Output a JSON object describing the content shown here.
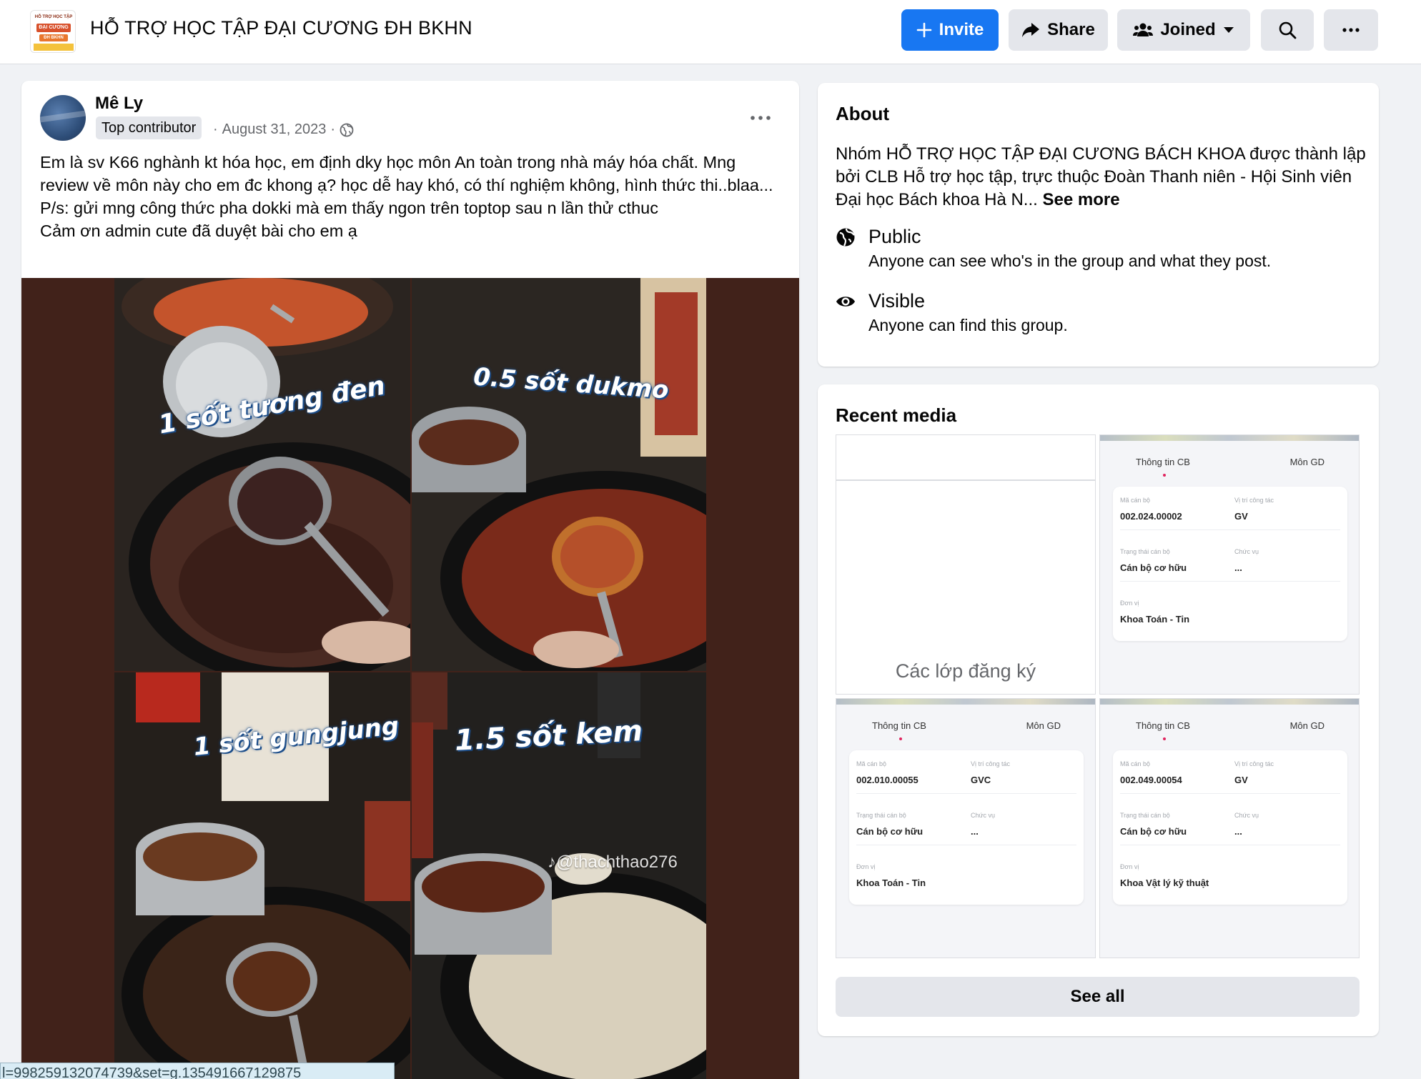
{
  "header": {
    "group_title": "HỖ TRỢ HỌC TẬP ĐẠI CƯƠNG ĐH BKHN",
    "logo_lines": [
      "HỖ TRỢ HỌC TẬP",
      "ĐẠI CƯƠNG",
      "ĐH BKHN"
    ],
    "invite_label": "Invite",
    "share_label": "Share",
    "joined_label": "Joined",
    "accent_color": "#1877f2"
  },
  "post": {
    "author": "Mê Ly",
    "badge": "Top contributor",
    "date": "August 31, 2023",
    "audience_icon": "globe-icon",
    "text_lines": [
      "Em là sv K66 nghành kt hóa học, em định dky học môn An toàn trong nhà máy hóa chất. Mng review về môn này cho em đc khong ạ? học dễ hay khó, có thí nghiệm không, hình thức thi..blaa...",
      "P/s: gửi mng công thức pha dokki mà em thấy ngon trên toptop sau n lần thử cthuc",
      "Cảm ơn admin cute đã duyệt bài cho em ạ"
    ],
    "image_labels": [
      "1 sốt tương đen",
      "0.5 sốt dukmo",
      "1 sốt gungjung",
      "1.5 sốt kem"
    ],
    "watermark": "♪@thachthao276",
    "status_url": "l=998259132074739&set=g.135491667129875"
  },
  "about": {
    "title": "About",
    "description": "Nhóm HỖ TRỢ HỌC TẬP ĐẠI CƯƠNG BÁCH KHOA được thành lập bởi CLB Hỗ trợ học tập, trực thuộc Đoàn Thanh niên - Hội Sinh viên Đại học Bách khoa Hà N...",
    "see_more": "See more",
    "privacy": {
      "title": "Public",
      "subtitle": "Anyone can see who's in the group and what they post."
    },
    "visibility": {
      "title": "Visible",
      "subtitle": "Anyone can find this group."
    }
  },
  "recent_media": {
    "title": "Recent media",
    "see_all": "See all",
    "blank_thumb_title": "Các lớp đăng ký",
    "thumbs": [
      {
        "tab1": "Thông tin CB",
        "tab2": "Môn GD",
        "l1": "Mã cán bộ",
        "v1": "002.024.00002",
        "l2": "Vị trí công tác",
        "v2": "GV",
        "l3": "Trạng thái cán bộ",
        "v3": "Cán bộ cơ hữu",
        "l4": "Chức vụ",
        "v4": "...",
        "l5": "Đơn vị",
        "v5": "Khoa Toán - Tin"
      },
      {
        "tab1": "Thông tin CB",
        "tab2": "Môn GD",
        "l1": "Mã cán bộ",
        "v1": "002.010.00055",
        "l2": "Vị trí công tác",
        "v2": "GVC",
        "l3": "Trạng thái cán bộ",
        "v3": "Cán bộ cơ hữu",
        "l4": "Chức vụ",
        "v4": "...",
        "l5": "Đơn vị",
        "v5": "Khoa Toán - Tin"
      },
      {
        "tab1": "Thông tin CB",
        "tab2": "Môn GD",
        "l1": "Mã cán bộ",
        "v1": "002.049.00054",
        "l2": "Vị trí công tác",
        "v2": "GV",
        "l3": "Trạng thái cán bộ",
        "v3": "Cán bộ cơ hữu",
        "l4": "Chức vụ",
        "v4": "...",
        "l5": "Đơn vị",
        "v5": "Khoa Vật lý kỹ thuật"
      }
    ]
  }
}
